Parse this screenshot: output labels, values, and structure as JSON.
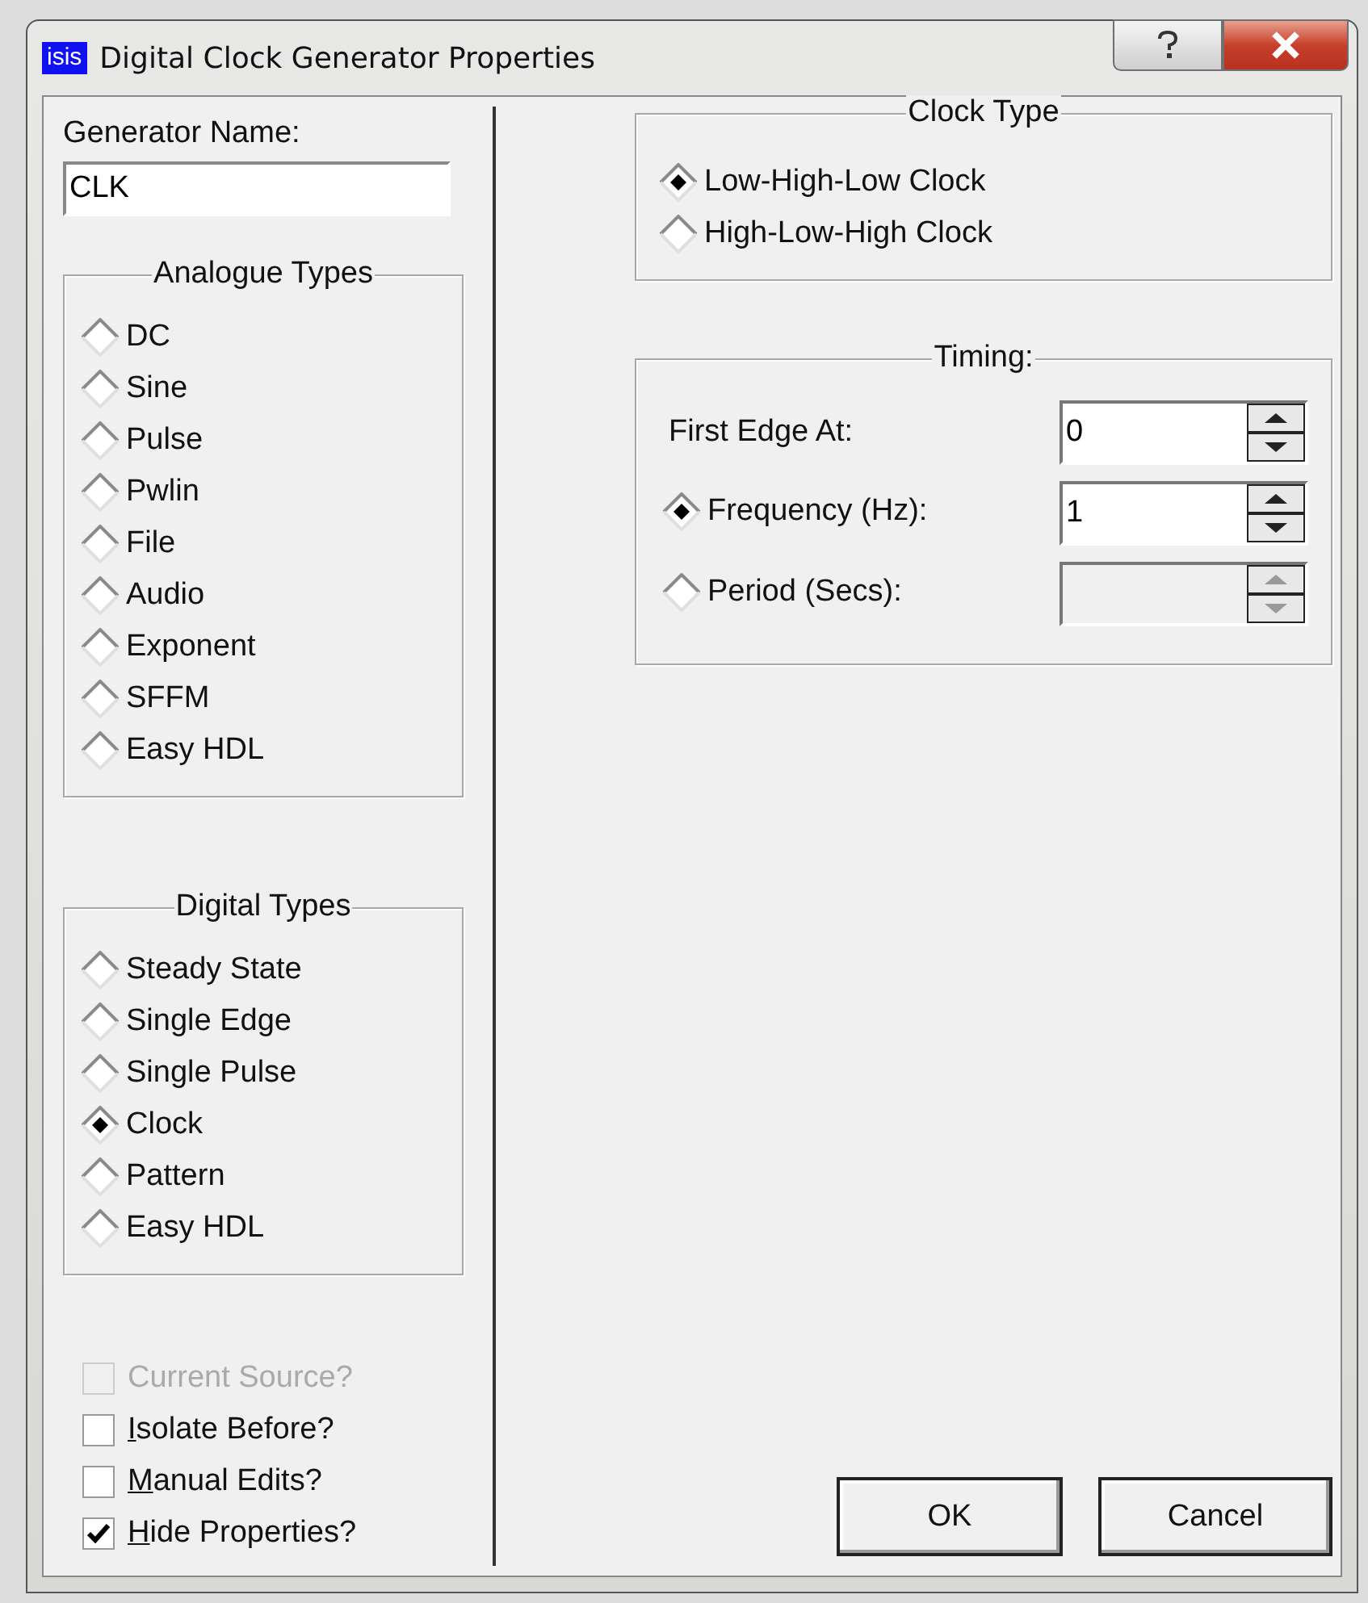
{
  "window": {
    "title": "Digital Clock Generator Properties",
    "app_badge": "isis"
  },
  "generator_name": {
    "label": "Generator Name:",
    "value": "CLK"
  },
  "analogue_types": {
    "title": "Analogue Types",
    "options": [
      {
        "label": "DC",
        "selected": false
      },
      {
        "label": "Sine",
        "selected": false
      },
      {
        "label": "Pulse",
        "selected": false
      },
      {
        "label": "Pwlin",
        "selected": false
      },
      {
        "label": "File",
        "selected": false
      },
      {
        "label": "Audio",
        "selected": false
      },
      {
        "label": "Exponent",
        "selected": false
      },
      {
        "label": "SFFM",
        "selected": false
      },
      {
        "label": "Easy HDL",
        "selected": false
      }
    ]
  },
  "digital_types": {
    "title": "Digital Types",
    "options": [
      {
        "label": "Steady State",
        "selected": false
      },
      {
        "label": "Single Edge",
        "selected": false
      },
      {
        "label": "Single Pulse",
        "selected": false
      },
      {
        "label": "Clock",
        "selected": true
      },
      {
        "label": "Pattern",
        "selected": false
      },
      {
        "label": "Easy HDL",
        "selected": false
      }
    ]
  },
  "checkboxes": [
    {
      "label": "Current Source?",
      "checked": false,
      "disabled": true,
      "access_key": false
    },
    {
      "label": "Isolate Before?",
      "checked": false,
      "disabled": false,
      "access_key": true
    },
    {
      "label": "Manual Edits?",
      "checked": false,
      "disabled": false,
      "access_key": true
    },
    {
      "label": "Hide Properties?",
      "checked": true,
      "disabled": false,
      "access_key": true
    }
  ],
  "clock_type": {
    "title": "Clock Type",
    "options": [
      {
        "label": "Low-High-Low Clock",
        "selected": true
      },
      {
        "label": "High-Low-High Clock",
        "selected": false
      }
    ]
  },
  "timing": {
    "title": "Timing:",
    "rows": [
      {
        "kind": "label",
        "label": "First Edge At:",
        "value": "0",
        "disabled": false
      },
      {
        "kind": "radio",
        "label": "Frequency (Hz):",
        "selected": true,
        "value": "1",
        "disabled": false
      },
      {
        "kind": "radio",
        "label": "Period (Secs):",
        "selected": false,
        "disabled": true
      }
    ]
  },
  "buttons": [
    {
      "label": "OK"
    },
    {
      "label": "Cancel"
    }
  ]
}
